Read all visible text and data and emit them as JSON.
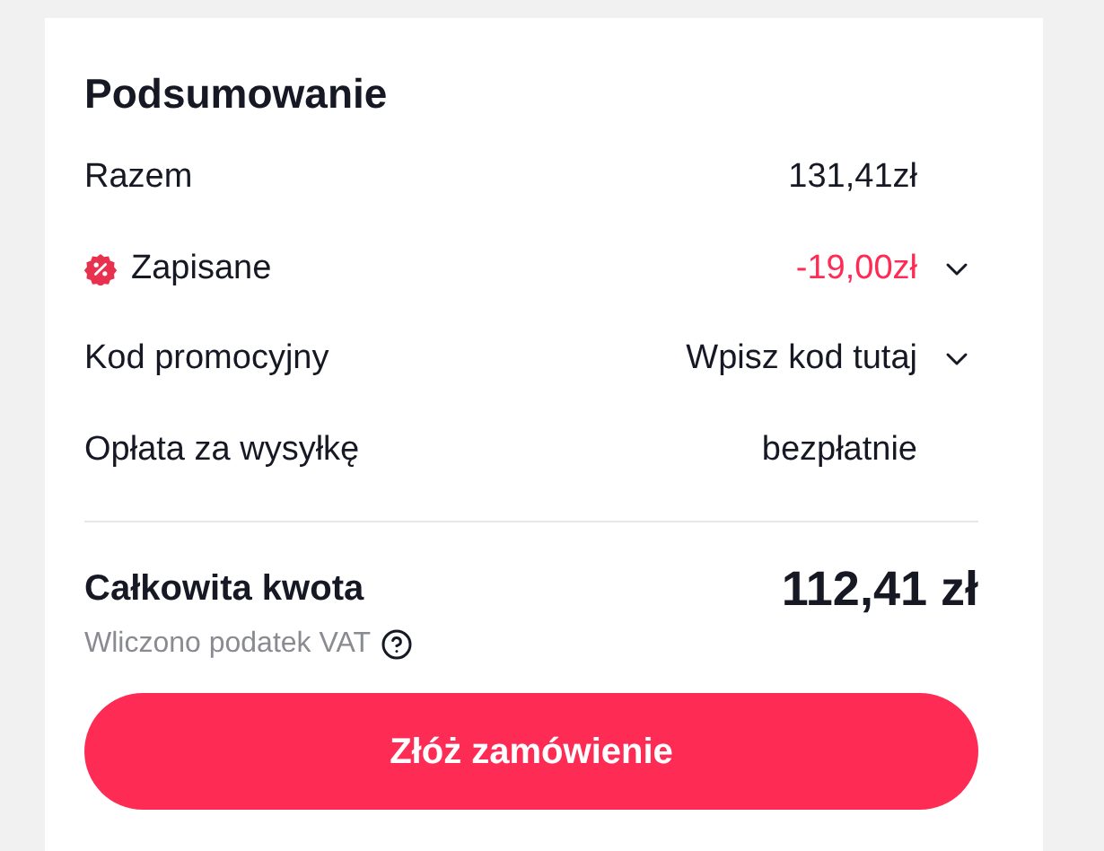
{
  "title": "Podsumowanie",
  "rows": [
    {
      "kind": "plain",
      "label": "Razem",
      "value": "131,41zł"
    },
    {
      "kind": "discount",
      "label": "Zapisane",
      "value": "-19,00zł"
    },
    {
      "kind": "dropdown",
      "label": "Kod promocyjny",
      "value": "Wpisz kod tutaj"
    },
    {
      "kind": "plain",
      "label": "Opłata za wysyłkę",
      "value": "bezpłatnie"
    }
  ],
  "total": {
    "label": "Całkowita kwota",
    "value": "112,41 zł",
    "note": "Wliczono podatek VAT"
  },
  "button": "Złóż zamówienie"
}
